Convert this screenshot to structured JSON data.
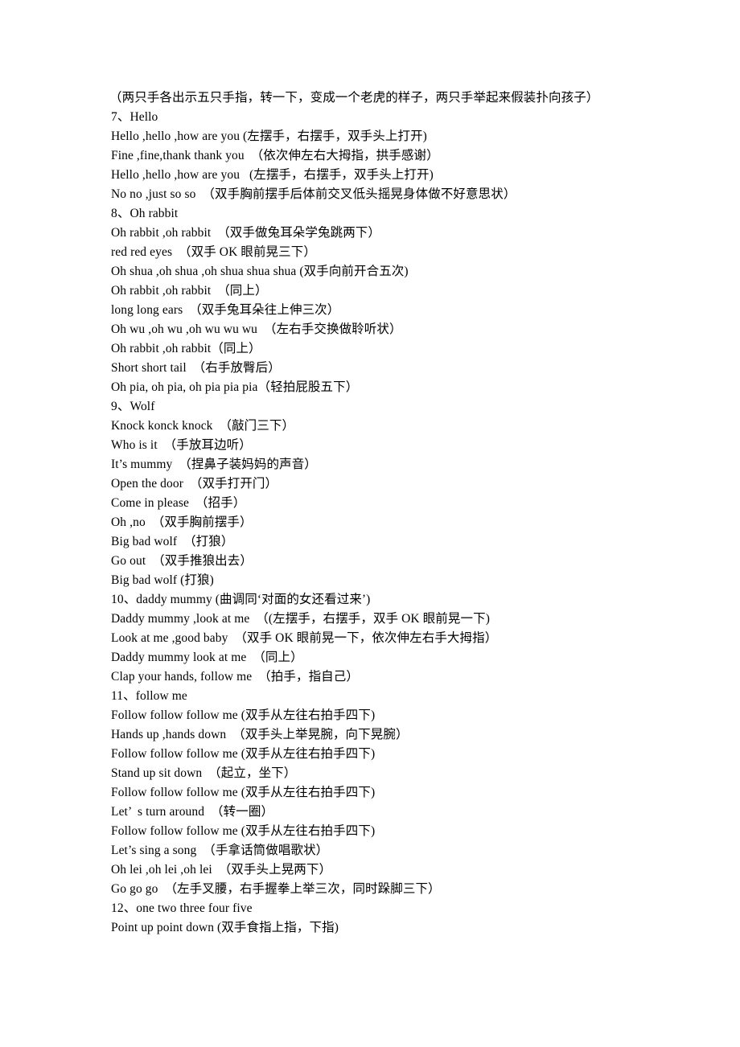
{
  "document": {
    "background_color": "#ffffff",
    "text_color": "#000000",
    "lines": [
      {
        "id": "l1",
        "text": "（两只手各出示五只手指，转一下，变成一个老虎的样子，两只手举起来假装扑向孩子）",
        "kind": "paren-note"
      },
      {
        "id": "l2",
        "text": "7、Hello",
        "kind": "section-heading"
      },
      {
        "id": "l3",
        "text": "Hello ,hello ,how are you (左摆手，右摆手，双手头上打开)",
        "kind": "lyric"
      },
      {
        "id": "l4",
        "text": "Fine ,fine,thank thank you  （依次伸左右大拇指，拱手感谢）",
        "kind": "lyric"
      },
      {
        "id": "l5",
        "text": "Hello ,hello ,how are you   (左摆手，右摆手，双手头上打开)",
        "kind": "lyric"
      },
      {
        "id": "l6",
        "text": "No no ,just so so  （双手胸前摆手后体前交叉低头摇晃身体做不好意思状）",
        "kind": "lyric"
      },
      {
        "id": "l7",
        "text": "8、Oh rabbit",
        "kind": "section-heading"
      },
      {
        "id": "l8",
        "text": "Oh rabbit ,oh rabbit  （双手做兔耳朵学兔跳两下）",
        "kind": "lyric"
      },
      {
        "id": "l9",
        "text": "red red eyes  （双手 OK 眼前晃三下）",
        "kind": "lyric"
      },
      {
        "id": "l10",
        "text": "Oh shua ,oh shua ,oh shua shua shua (双手向前开合五次)",
        "kind": "lyric"
      },
      {
        "id": "l11",
        "text": "Oh rabbit ,oh rabbit  （同上）",
        "kind": "lyric"
      },
      {
        "id": "l12",
        "text": "long long ears  （双手兔耳朵往上伸三次）",
        "kind": "lyric"
      },
      {
        "id": "l13",
        "text": "Oh wu ,oh wu ,oh wu wu wu  （左右手交换做聆听状）",
        "kind": "lyric"
      },
      {
        "id": "l14",
        "text": "Oh rabbit ,oh rabbit（同上）",
        "kind": "lyric"
      },
      {
        "id": "l15",
        "text": "Short short tail  （右手放臀后）",
        "kind": "lyric"
      },
      {
        "id": "l16",
        "text": "Oh pia, oh pia, oh pia pia pia（轻拍屁股五下）",
        "kind": "lyric"
      },
      {
        "id": "l17",
        "text": "9、Wolf",
        "kind": "section-heading"
      },
      {
        "id": "l18",
        "text": "Knock konck knock  （敲门三下）",
        "kind": "lyric"
      },
      {
        "id": "l19",
        "text": "Who is it  （手放耳边听）",
        "kind": "lyric"
      },
      {
        "id": "l20",
        "text": "It’s mummy  （捏鼻子装妈妈的声音）",
        "kind": "lyric"
      },
      {
        "id": "l21",
        "text": "Open the door  （双手打开门）",
        "kind": "lyric"
      },
      {
        "id": "l22",
        "text": "Come in please  （招手）",
        "kind": "lyric"
      },
      {
        "id": "l23",
        "text": "Oh ,no  （双手胸前摆手）",
        "kind": "lyric"
      },
      {
        "id": "l24",
        "text": "Big bad wolf  （打狼）",
        "kind": "lyric"
      },
      {
        "id": "l25",
        "text": "Go out  （双手推狼出去）",
        "kind": "lyric"
      },
      {
        "id": "l26",
        "text": "Big bad wolf (打狼)",
        "kind": "lyric"
      },
      {
        "id": "l27",
        "text": "10、daddy mummy (曲调同‘对面的女还看过来’)",
        "kind": "section-heading"
      },
      {
        "id": "l28",
        "text": "Daddy mummy ,look at me  （(左摆手，右摆手，双手 OK 眼前晃一下)",
        "kind": "lyric"
      },
      {
        "id": "l29",
        "text": "Look at me ,good baby  （双手 OK 眼前晃一下，依次伸左右手大拇指）",
        "kind": "lyric"
      },
      {
        "id": "l30",
        "text": "Daddy mummy look at me  （同上）",
        "kind": "lyric"
      },
      {
        "id": "l31",
        "text": "Clap your hands, follow me  （拍手，指自己）",
        "kind": "lyric"
      },
      {
        "id": "l32",
        "text": "11、follow me",
        "kind": "section-heading"
      },
      {
        "id": "l33",
        "text": "Follow follow follow me (双手从左往右拍手四下)",
        "kind": "lyric"
      },
      {
        "id": "l34",
        "text": "Hands up ,hands down  （双手头上举晃腕，向下晃腕）",
        "kind": "lyric"
      },
      {
        "id": "l35",
        "text": "Follow follow follow me (双手从左往右拍手四下)",
        "kind": "lyric"
      },
      {
        "id": "l36",
        "text": "Stand up sit down  （起立，坐下）",
        "kind": "lyric"
      },
      {
        "id": "l37",
        "text": "Follow follow follow me (双手从左往右拍手四下)",
        "kind": "lyric"
      },
      {
        "id": "l38",
        "text": "Let’  s turn around  （转一圈）",
        "kind": "lyric"
      },
      {
        "id": "l39",
        "text": "Follow follow follow me (双手从左往右拍手四下)",
        "kind": "lyric"
      },
      {
        "id": "l40",
        "text": "Let’s sing a song  （手拿话筒做唱歌状）",
        "kind": "lyric"
      },
      {
        "id": "l41",
        "text": "Oh lei ,oh lei ,oh lei  （双手头上晃两下）",
        "kind": "lyric"
      },
      {
        "id": "l42",
        "text": "Go go go  （左手叉腰，右手握拳上举三次，同时跺脚三下）",
        "kind": "lyric"
      },
      {
        "id": "l43",
        "text": "12、one two three four five",
        "kind": "section-heading"
      },
      {
        "id": "l44",
        "text": "Point up point down (双手食指上指，下指)",
        "kind": "lyric"
      }
    ]
  }
}
